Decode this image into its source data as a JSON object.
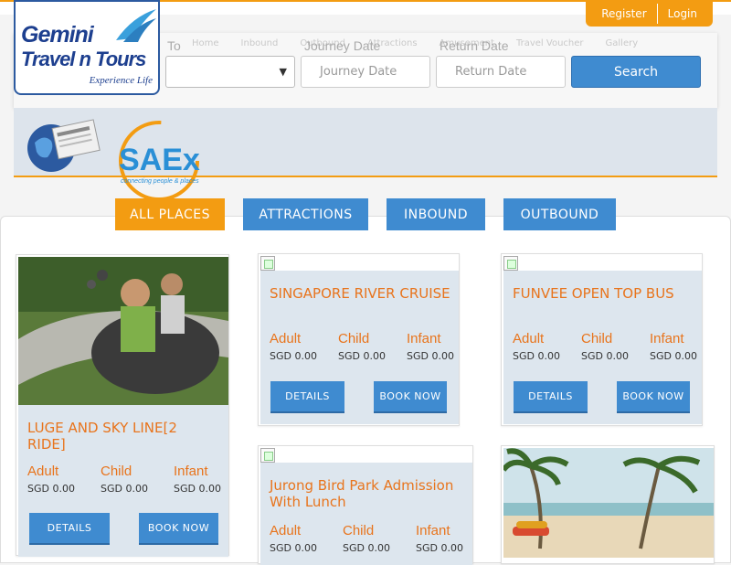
{
  "auth": {
    "register": "Register",
    "login": "Login"
  },
  "logo": {
    "line1": "Gemini",
    "line2": "Travel n Tours",
    "tagline": "Experience Life"
  },
  "ghost_nav": [
    "Home",
    "Inbound",
    "Outbound",
    "Attractions",
    "Amusement",
    "Travel Voucher",
    "Gallery"
  ],
  "search": {
    "to_label": "To",
    "journey_label": "Journey Date",
    "return_label": "Return Date",
    "journey_placeholder": "Journey Date",
    "return_placeholder": "Return Date",
    "button": "Search"
  },
  "tabs": [
    "ALL PLACES",
    "ATTRACTIONS",
    "INBOUND",
    "OUTBOUND"
  ],
  "saex": {
    "name": "SAEx",
    "tagline": "connecting people & places"
  },
  "price_labels": {
    "adult": "Adult",
    "child": "Child",
    "infant": "Infant"
  },
  "buttons": {
    "details": "DETAILS",
    "book": "BOOK NOW"
  },
  "cards": [
    {
      "title": "LUGE AND SKY LINE[2 RIDE]",
      "adult": "SGD 0.00",
      "child": "SGD 0.00",
      "infant": "SGD 0.00"
    },
    {
      "title": "SINGAPORE RIVER CRUISE",
      "adult": "SGD 0.00",
      "child": "SGD 0.00",
      "infant": "SGD 0.00"
    },
    {
      "title": "FUNVEE OPEN TOP BUS",
      "adult": "SGD 0.00",
      "child": "SGD 0.00",
      "infant": "SGD 0.00"
    },
    {
      "title": "Jurong Bird Park Admission With Lunch",
      "adult": "SGD 0.00",
      "child": "SGD 0.00",
      "infant": "SGD 0.00"
    }
  ],
  "colors": {
    "accent": "#f39c12",
    "primary": "#3f8bd0",
    "title": "#e8741c",
    "card_bg": "#dde6ee"
  }
}
